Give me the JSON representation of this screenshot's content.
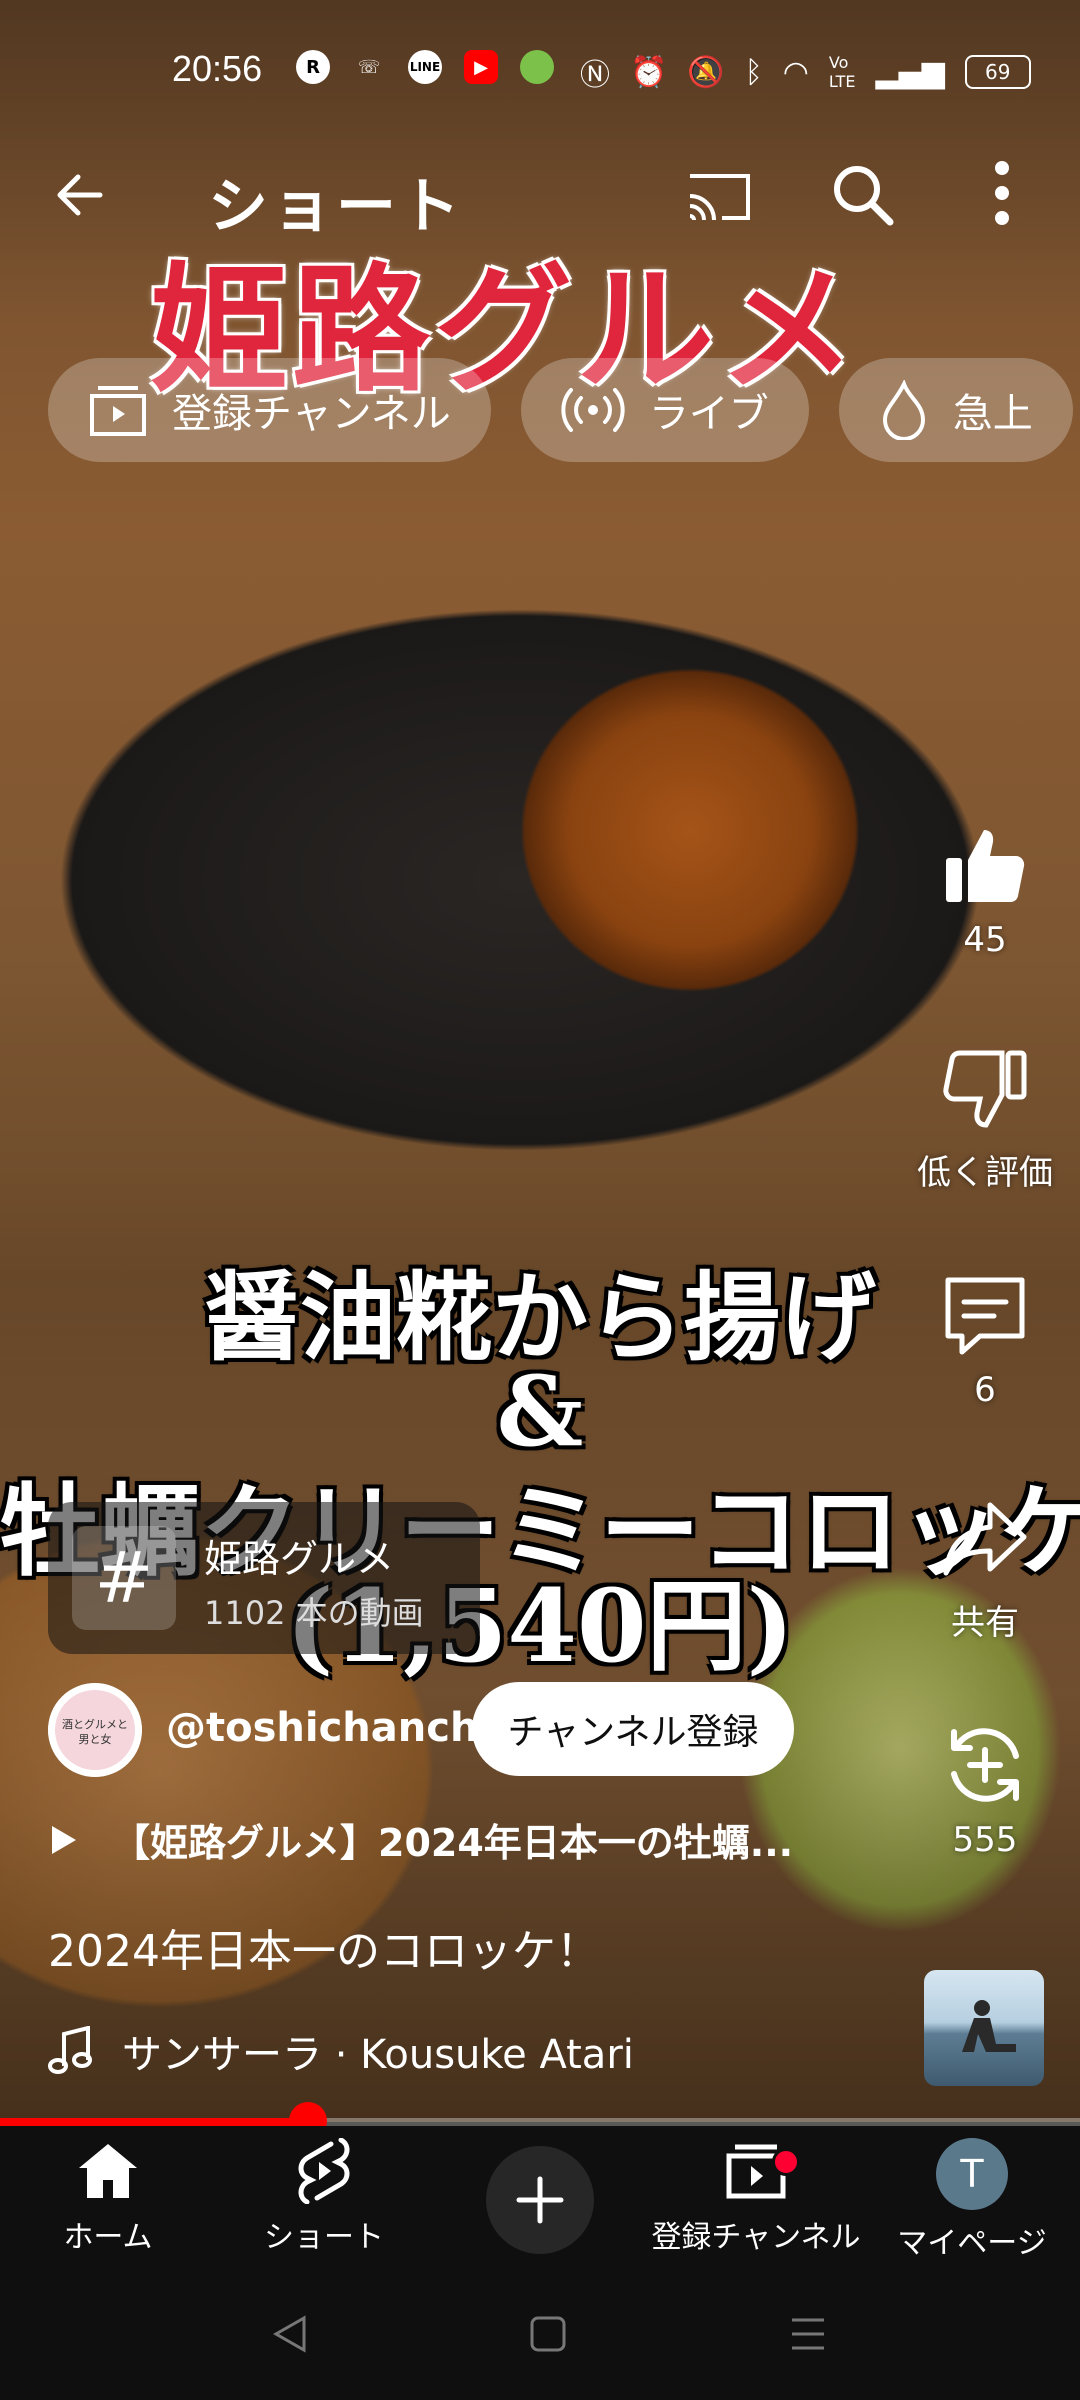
{
  "status_bar": {
    "time": "20:56",
    "battery": "69",
    "left_icons": [
      "rakuten-icon",
      "missed-call-icon",
      "line-icon",
      "youtube-icon",
      "android-icon"
    ],
    "right_icons": [
      "nfc-icon",
      "alarm-icon",
      "mute-icon",
      "bluetooth-icon",
      "wifi-icon",
      "volte-icon",
      "signal-icon"
    ]
  },
  "topbar": {
    "title": "ショート"
  },
  "video": {
    "overlay_title": "姫路グルメ",
    "caption_line1": "醤油糀から揚げ",
    "caption_line2": "&",
    "caption_line3": "牡蠣クリーミーコロッケ",
    "caption_line4": "(1,540円)",
    "progress_fraction": 0.285
  },
  "chips": [
    {
      "label": "登録チャンネル",
      "icon": "subscriptions-icon"
    },
    {
      "label": "ライブ",
      "icon": "live-icon"
    },
    {
      "label": "急上",
      "icon": "trending-icon"
    }
  ],
  "actions": {
    "like_count": "45",
    "dislike_label": "低く評価",
    "comment_count": "6",
    "share_label": "共有",
    "remix_count": "555"
  },
  "hashtag_card": {
    "symbol": "#",
    "title": "姫路グルメ",
    "subtitle": "1102 本の動画"
  },
  "channel": {
    "handle": "@toshichanchi",
    "subscribe_label": "チャンネル登録",
    "avatar_text": "酒とグルメと男と女"
  },
  "playlist_title": "【姫路グルメ】2024年日本一の牡蠣...",
  "description": "2024年日本一のコロッケ！",
  "music": {
    "label": "サンサーラ · Kousuke Atari"
  },
  "bottom_nav": [
    {
      "label": "ホーム",
      "icon": "home-icon"
    },
    {
      "label": "ショート",
      "icon": "shorts-icon"
    },
    {
      "label": "",
      "icon": "create-icon"
    },
    {
      "label": "登録チャンネル",
      "icon": "subscriptions-icon"
    },
    {
      "label": "マイページ",
      "icon": "avatar-icon"
    }
  ],
  "mypage_initial": "T",
  "colors": {
    "accent": "#ff0000",
    "title_red": "#e0263c",
    "nav_bg": "#0f0f0f"
  }
}
